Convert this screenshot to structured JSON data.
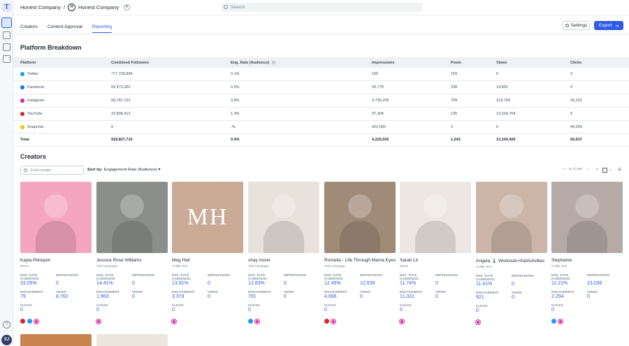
{
  "rail": {
    "logo": "T",
    "user_initials": "SJ",
    "help": "?"
  },
  "header": {
    "org": "Honest Company",
    "separator": "/",
    "brand_badge": "H",
    "brand": "Honest Company",
    "search_placeholder": "Search"
  },
  "tabs": [
    {
      "label": "Creators",
      "active": false
    },
    {
      "label": "Content Approval",
      "active": false
    },
    {
      "label": "Reporting",
      "active": true
    }
  ],
  "actions": {
    "settings_label": "Settings",
    "export_label": "Export"
  },
  "platform_breakdown": {
    "title": "Platform Breakdown",
    "columns": [
      "Platform",
      "Combined Followers",
      "Eng. Rate (Audience)",
      "Impressions",
      "Posts",
      "Views",
      "Clicks"
    ],
    "rows": [
      {
        "platform": "Twitter",
        "icon": "twitter-icon",
        "color": "#1d9bf0",
        "followers": "777,728,894",
        "eng_rate": "0.1%",
        "impressions": "165",
        "posts": "159",
        "views": "0",
        "clicks": "3"
      },
      {
        "platform": "Facebook",
        "icon": "facebook-icon",
        "color": "#1877f2",
        "followers": "69,473,282",
        "eng_rate": "0.5%",
        "impressions": "29,778",
        "posts": "238",
        "views": "14,852",
        "clicks": "3"
      },
      {
        "platform": "Instagram",
        "icon": "instagram-icon",
        "color": "#d6249f",
        "followers": "58,787,122",
        "eng_rate": "3.9%",
        "impressions": "3,736,255",
        "posts": "709",
        "views": "123,793",
        "clicks": "26,222"
      },
      {
        "platform": "YouTube",
        "icon": "youtube-icon",
        "color": "#e02424",
        "followers": "22,838,412",
        "eng_rate": "1.3%",
        "impressions": "37,304",
        "posts": "135",
        "views": "13,204,764",
        "clicks": "0"
      },
      {
        "platform": "Snapchat",
        "icon": "snapchat-icon",
        "color": "#f5c400",
        "followers": "0",
        "eng_rate": "-%",
        "impressions": "422,000",
        "posts": "2",
        "views": "0",
        "clicks": "44,309"
      }
    ],
    "total": {
      "label": "Total",
      "followers": "918,827,710",
      "eng_rate": "0.4%",
      "impressions": "4,225,502",
      "posts": "1,243",
      "views": "13,343,409",
      "clicks": "69,537"
    }
  },
  "creators": {
    "title": "Creators",
    "search_placeholder": "Find creator",
    "sort_label": "Sort by:",
    "sort_value": "Engagement Rate (Audience)",
    "pagination": "1 - 10 of 356",
    "stat_labels": {
      "eng_rate": "ENG. RATE (AUDIENCE)",
      "impressions": "IMPRESSIONS",
      "engagement": "ENGAGEMENT",
      "views": "VIEWS",
      "clicks": "CLICKS"
    },
    "cards": [
      {
        "name": "Kayla Peloquin",
        "sub": "Moms",
        "eng_rate": "33.05%",
        "impressions": "0",
        "engagement": "79",
        "views": "8,762",
        "clicks": "0",
        "photo_bg": "#f4a6c0",
        "socials": [
          "youtube",
          "twitter",
          "instagram"
        ]
      },
      {
        "name": "Jessica Rose Williams",
        "sub": "Test Campaign",
        "eng_rate": "14.41%",
        "impressions": "0",
        "engagement": "1,963",
        "views": "0",
        "clicks": "0",
        "photo_bg": "#8a8f8a",
        "socials": [
          "instagram"
        ]
      },
      {
        "name": "Meg Hall",
        "sub": "Collab Test",
        "eng_rate": "13.91%",
        "impressions": "0",
        "engagement": "3,379",
        "views": "0",
        "clicks": "0",
        "photo_bg": "#c9ab98",
        "logo_text": "MH",
        "socials": [
          "instagram"
        ]
      },
      {
        "name": "shay mone",
        "sub": "Test Campaign",
        "eng_rate": "12.83%",
        "impressions": "0",
        "engagement": "791",
        "views": "0",
        "clicks": "0",
        "photo_bg": "#e8e2da",
        "socials": [
          "twitter",
          "instagram"
        ]
      },
      {
        "name": "Romelia - Life Through Mama Eyes",
        "sub": "Test Campaign",
        "eng_rate": "12.49%",
        "impressions": "12,539",
        "engagement": "4,666",
        "views": "0",
        "clicks": "0",
        "photo_bg": "#a08a78",
        "socials": [
          "youtube",
          "instagram"
        ]
      },
      {
        "name": "Sarah Lit",
        "sub": "Moms",
        "eng_rate": "11.74%",
        "impressions": "0",
        "engagement": "11,022",
        "views": "0",
        "clicks": "0",
        "photo_bg": "#ede7e2",
        "socials": [
          "instagram"
        ]
      },
      {
        "name": "Angela 🌡 Workouts+KidActivities",
        "sub": "Collab Test",
        "eng_rate": "11.41%",
        "impressions": "0",
        "engagement": "921",
        "views": "0",
        "clicks": "0",
        "photo_bg": "#cbb5a8",
        "socials": [
          "instagram"
        ]
      },
      {
        "name": "Stephanie",
        "sub": "Collab Test",
        "eng_rate": "11.21%",
        "impressions": "23,036",
        "engagement": "2,294",
        "views": "0",
        "clicks": "0",
        "photo_bg": "#b7a9a6",
        "socials": [
          "twitter",
          "instagram"
        ]
      }
    ]
  }
}
